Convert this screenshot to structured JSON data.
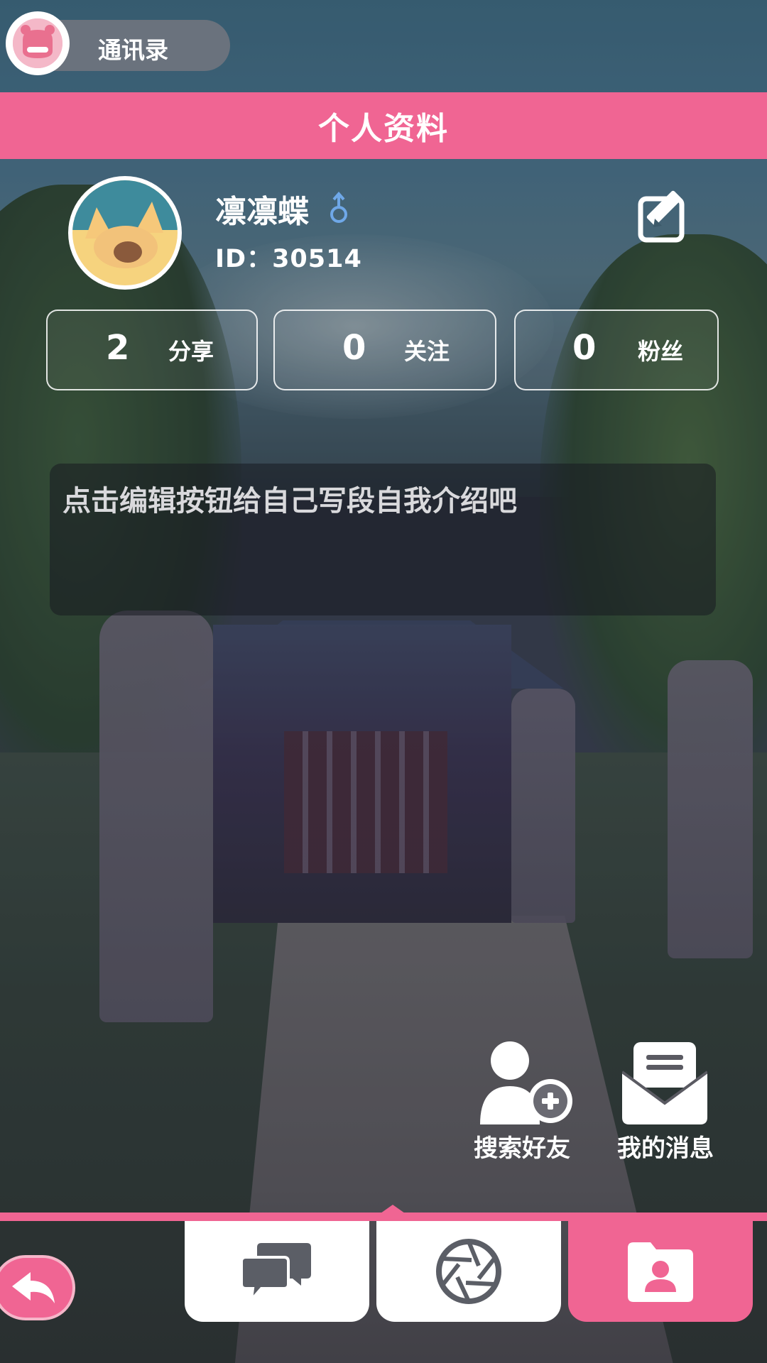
{
  "top": {
    "contacts_label": "通讯录"
  },
  "header": {
    "title": "个人资料"
  },
  "profile": {
    "username": "凛凛蝶",
    "gender_symbol": "♂",
    "id_text": "ID：30514"
  },
  "stats": [
    {
      "value": "2",
      "label": "分享"
    },
    {
      "value": "0",
      "label": "关注"
    },
    {
      "value": "0",
      "label": "粉丝"
    }
  ],
  "bio": {
    "placeholder": "点击编辑按钮给自己写段自我介绍吧"
  },
  "actions": {
    "search_friends": "搜索好友",
    "my_messages": "我的消息"
  },
  "nav": {
    "tabs": [
      {
        "icon": "chat-bubbles-icon",
        "active": false
      },
      {
        "icon": "camera-shutter-icon",
        "active": false
      },
      {
        "icon": "profile-folder-icon",
        "active": true
      }
    ]
  },
  "icons": [
    "contacts-avatar-icon",
    "edit-icon",
    "male-gender-icon",
    "add-friend-icon",
    "mail-icon",
    "back-arrow-icon"
  ],
  "colors": {
    "accent": "#f06593",
    "gender": "#6fa8e8"
  }
}
